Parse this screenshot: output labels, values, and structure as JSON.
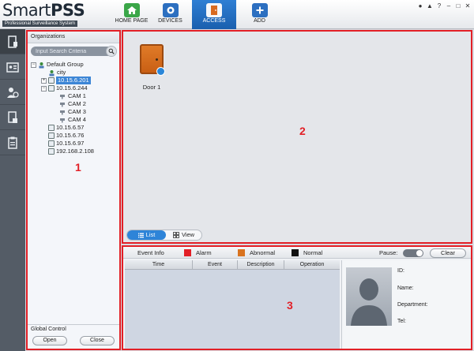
{
  "app": {
    "brand_regular": "Smart",
    "brand_bold": "PSS",
    "tagline": "Professional Surveillance System"
  },
  "nav": [
    {
      "label": "HOME PAGE",
      "icon": "home-icon",
      "color": "#3aa648"
    },
    {
      "label": "DEVICES",
      "icon": "camera-icon",
      "color": "#2c6fc0"
    },
    {
      "label": "ACCESS",
      "icon": "door-icon",
      "color": "#d86a20",
      "active": true
    },
    {
      "label": "ADD",
      "icon": "plus-icon",
      "color": "#2c6fc0"
    }
  ],
  "window_controls": [
    "user-icon",
    "lock-icon",
    "help-icon",
    "minimize-icon",
    "restore-icon",
    "close-icon"
  ],
  "organizations": {
    "title": "Organizations",
    "search_placeholder": "Input Search Criteria",
    "tree": [
      {
        "label": "Default Group",
        "indent": 0,
        "expander": "−",
        "icon": "group-icon"
      },
      {
        "label": "city",
        "indent": 1,
        "icon": "group-icon"
      },
      {
        "label": "10.15.6.201",
        "indent": 1,
        "expander": "+",
        "icon": "device-icon",
        "selected": true
      },
      {
        "label": "10.15.6.244",
        "indent": 1,
        "expander": "−",
        "icon": "device-icon"
      },
      {
        "label": "CAM 1",
        "indent": 2,
        "icon": "cam-icon"
      },
      {
        "label": "CAM 2",
        "indent": 2,
        "icon": "cam-icon"
      },
      {
        "label": "CAM 3",
        "indent": 2,
        "icon": "cam-icon"
      },
      {
        "label": "CAM 4",
        "indent": 2,
        "icon": "cam-icon"
      },
      {
        "label": "10.15.6.57",
        "indent": 1,
        "icon": "device-icon"
      },
      {
        "label": "10.15.6.76",
        "indent": 1,
        "icon": "device-icon"
      },
      {
        "label": "10.15.6.97",
        "indent": 1,
        "icon": "device-icon"
      },
      {
        "label": "192.168.2.108",
        "indent": 1,
        "icon": "device-icon"
      }
    ],
    "global_control": "Global Control",
    "open_label": "Open",
    "close_label": "Close"
  },
  "door_area": {
    "doors": [
      {
        "label": "Door 1"
      }
    ],
    "list_label": "List",
    "view_label": "View"
  },
  "event_area": {
    "event_info": "Event Info",
    "legend": [
      {
        "label": "Alarm",
        "color": "#e21f26"
      },
      {
        "label": "Abnormal",
        "color": "#d9731f"
      },
      {
        "label": "Normal",
        "color": "#111111"
      }
    ],
    "pause_label": "Pause:",
    "clear_label": "Clear",
    "columns": [
      "Time",
      "Event",
      "Description",
      "Operation"
    ],
    "info_fields": [
      "ID:",
      "Name:",
      "Department:",
      "Tel:"
    ]
  },
  "markers": [
    "1",
    "2",
    "3"
  ]
}
